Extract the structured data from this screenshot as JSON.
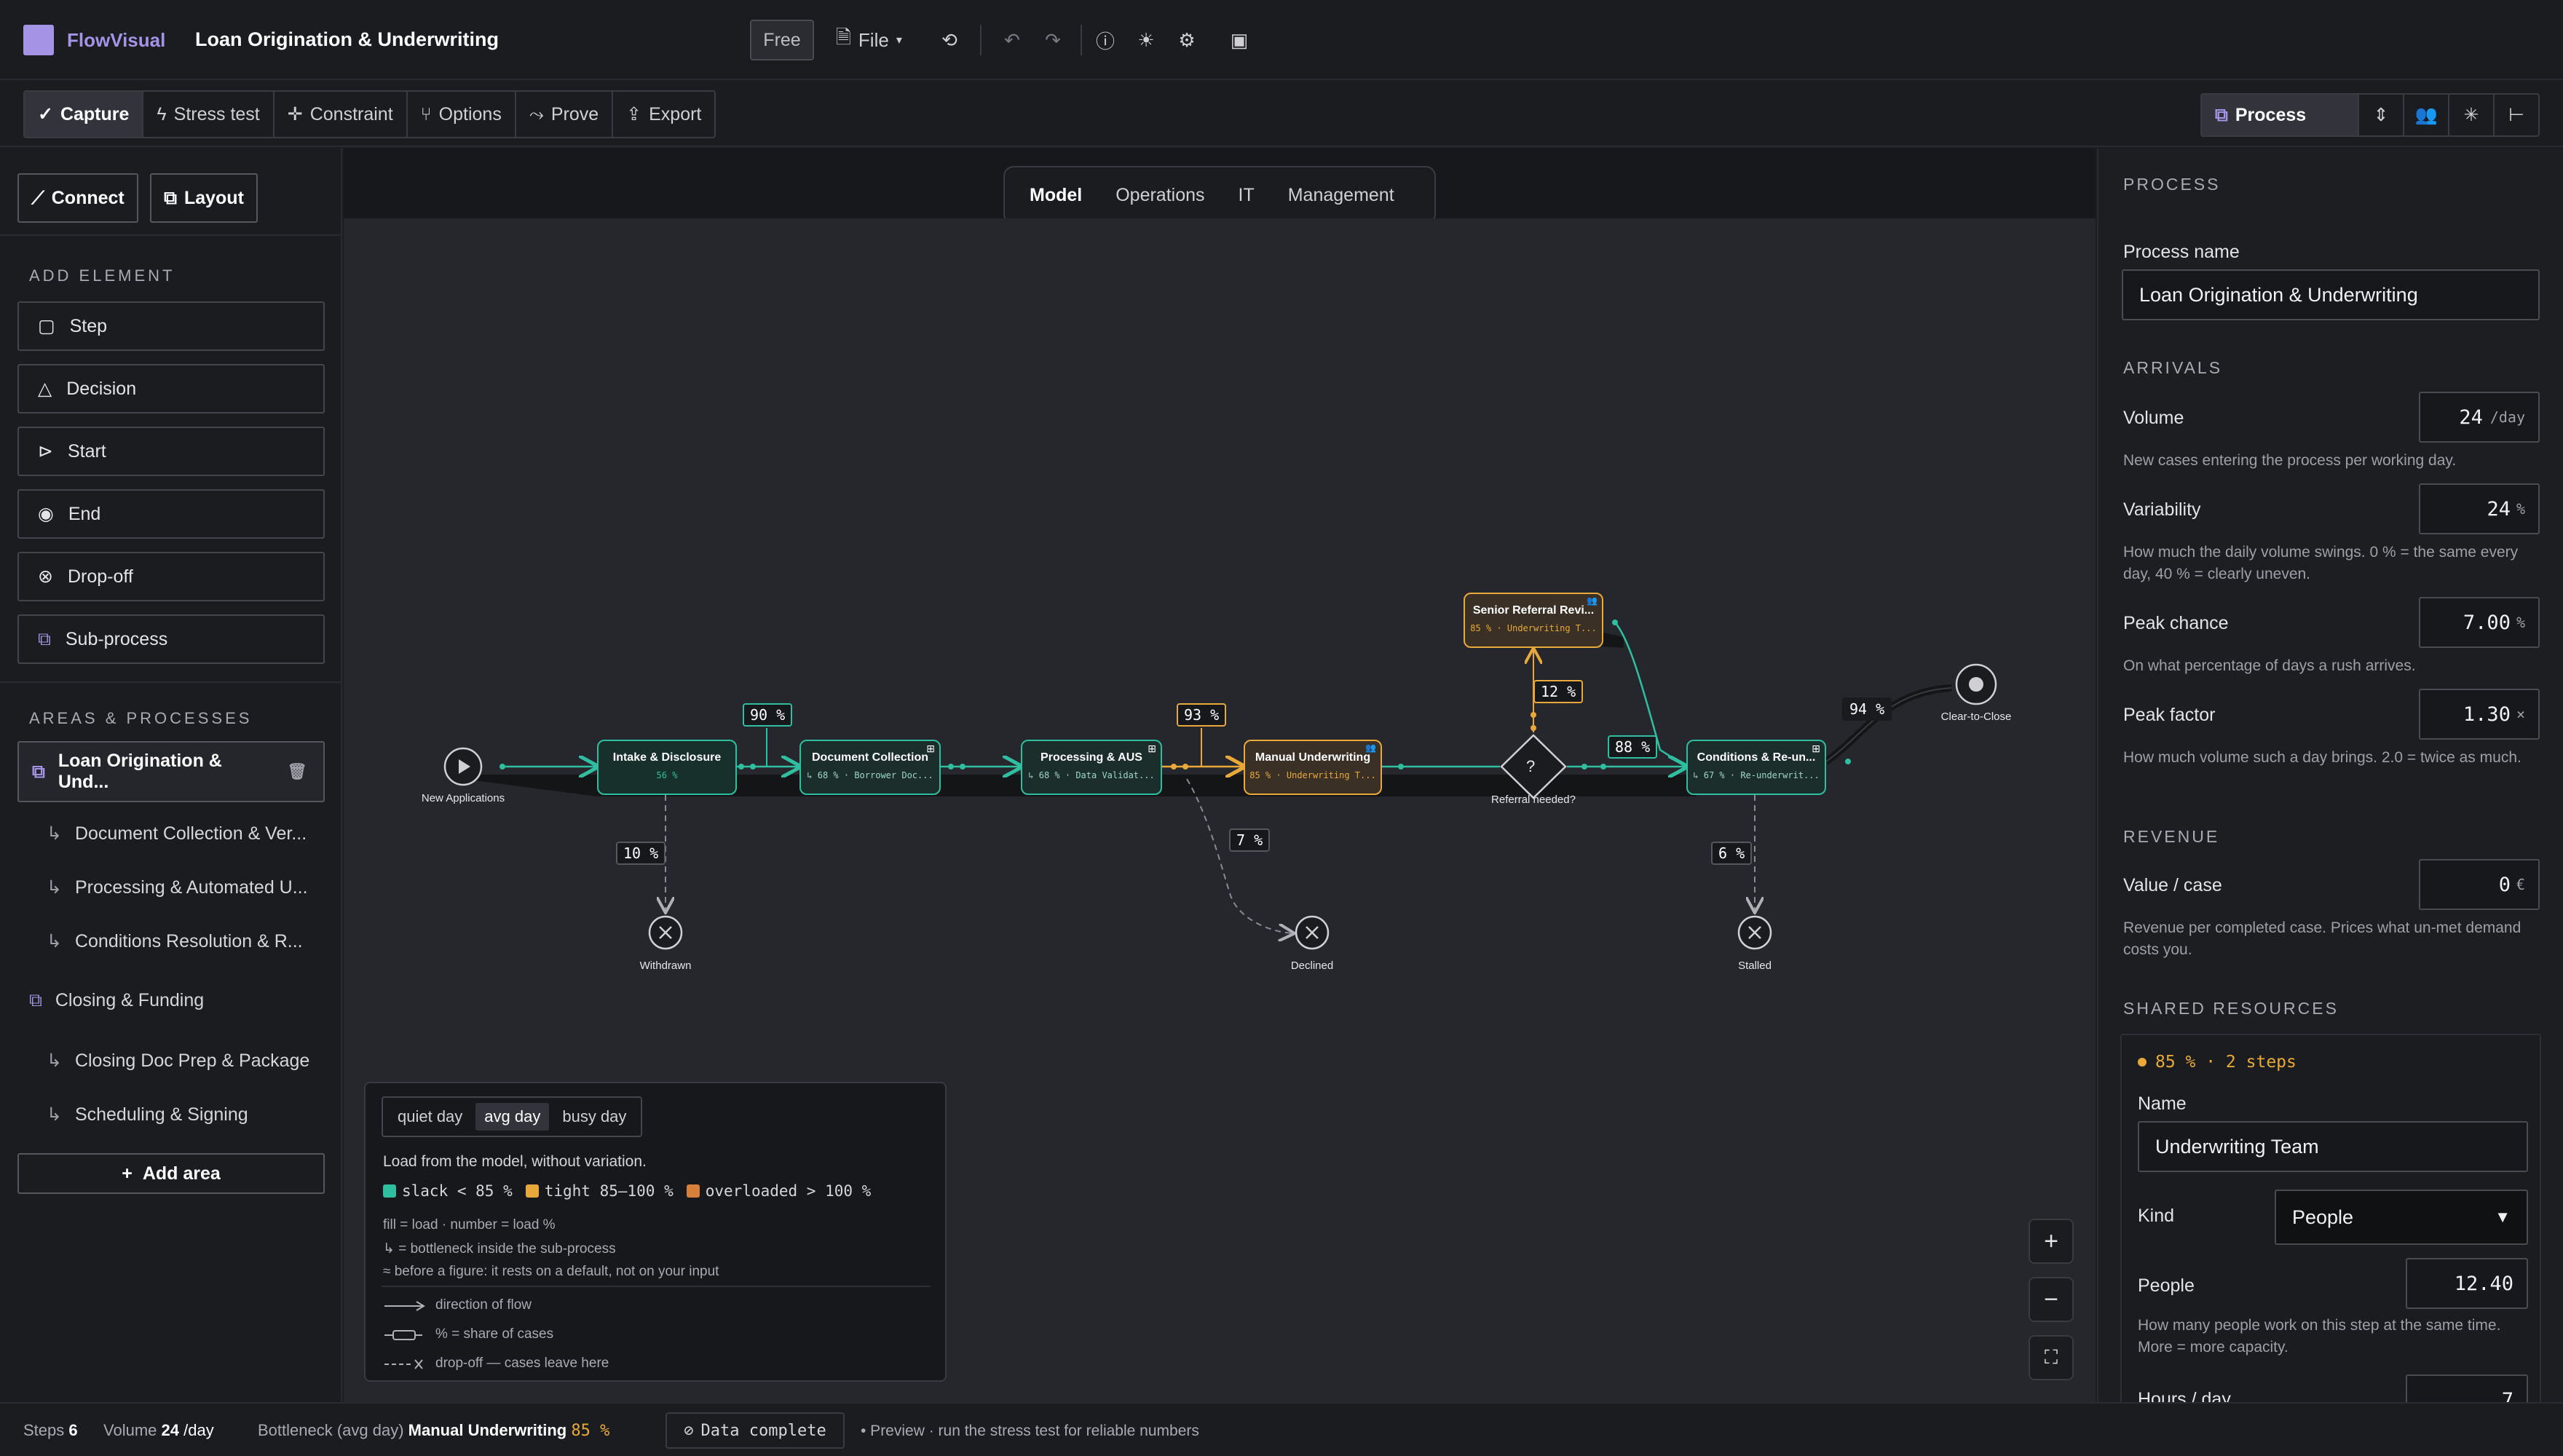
{
  "app": {
    "brand": "FlowVisual",
    "title": "Loan Origination & Underwriting",
    "plan_badge": "Free",
    "file_menu": "File"
  },
  "ribbon": {
    "modes": [
      "Capture",
      "Stress test",
      "Constraint",
      "Options",
      "Prove",
      "Export"
    ],
    "view_select": "Process"
  },
  "left": {
    "connect": "Connect",
    "layout": "Layout",
    "add_element_title": "ADD ELEMENT",
    "elements": [
      "Step",
      "Decision",
      "Start",
      "End",
      "Drop-off",
      "Sub-process"
    ],
    "areas_title": "AREAS & PROCESSES",
    "areas": [
      {
        "label": "Loan Origination & Und...",
        "level": 0,
        "selected": true
      },
      {
        "label": "Document Collection & Ver...",
        "level": 1
      },
      {
        "label": "Processing & Automated U...",
        "level": 1
      },
      {
        "label": "Conditions Resolution & R...",
        "level": 1
      },
      {
        "label": "Closing & Funding",
        "level": 0
      },
      {
        "label": "Closing Doc Prep & Package",
        "level": 1
      },
      {
        "label": "Scheduling & Signing",
        "level": 1
      }
    ],
    "add_area": "Add area"
  },
  "canvas": {
    "tabs": [
      "Model",
      "Operations",
      "IT",
      "Management"
    ],
    "active_tab": "Model",
    "nodes": {
      "start": "New Applications",
      "intake": {
        "title": "Intake & Disclosure",
        "sub": "56 %"
      },
      "doc": {
        "title": "Document Collection",
        "sub": "↳ 68 % · Borrower Doc..."
      },
      "proc": {
        "title": "Processing & AUS",
        "sub": "↳ 68 % · Data Validat..."
      },
      "manual": {
        "title": "Manual Underwriting",
        "sub": "85 % · Underwriting T..."
      },
      "senior": {
        "title": "Senior Referral Revi...",
        "sub": "85 % · Underwriting T..."
      },
      "cond": {
        "title": "Conditions & Re-un...",
        "sub": "↳ 67 % · Re-underwrit..."
      },
      "decision": "Referral needed?",
      "decision_mark": "?",
      "end": "Clear-to-Close",
      "withdrawn": "Withdrawn",
      "declined": "Declined",
      "stalled": "Stalled"
    },
    "edges": {
      "e90": "90 %",
      "e93": "93 %",
      "e12": "12 %",
      "e88": "88 %",
      "e94": "94 %",
      "e10": "10 %",
      "e7": "7 %",
      "e6": "6 %"
    }
  },
  "legend": {
    "days": [
      "quiet day",
      "avg day",
      "busy day"
    ],
    "active_day": "avg day",
    "desc": "Load from the model, without variation.",
    "slack": "slack < 85 %",
    "tight": "tight 85–100 %",
    "overloaded": "overloaded > 100 %",
    "notes": [
      "fill = load · number = load %",
      "↳ = bottleneck inside the sub-process",
      "≈ before a figure: it rests on a default, not on your input"
    ],
    "keys": [
      "direction of flow",
      "% = share of cases",
      "drop-off — cases leave here"
    ]
  },
  "right": {
    "section": "PROCESS",
    "process_name_label": "Process name",
    "process_name": "Loan Origination & Underwriting",
    "arrivals": "ARRIVALS",
    "volume_label": "Volume",
    "volume": "24",
    "volume_unit": "/day",
    "volume_help": "New cases entering the process per working day.",
    "variability_label": "Variability",
    "variability": "24",
    "variability_unit": "%",
    "variability_help": "How much the daily volume swings. 0 % = the same every day, 40 % = clearly uneven.",
    "peak_chance_label": "Peak chance",
    "peak_chance": "7.00",
    "peak_chance_unit": "%",
    "peak_chance_help": "On what percentage of days a rush arrives.",
    "peak_factor_label": "Peak factor",
    "peak_factor": "1.30",
    "peak_factor_unit": "×",
    "peak_factor_help": "How much volume such a day brings. 2.0 = twice as much.",
    "revenue": "REVENUE",
    "value_label": "Value / case",
    "value": "0",
    "value_unit": "€",
    "value_help": "Revenue per completed case. Prices what un-met demand costs you.",
    "shared": "SHARED RESOURCES",
    "res_summary": "85 % · 2 steps",
    "name_label": "Name",
    "res_name": "Underwriting Team",
    "kind_label": "Kind",
    "kind": "People",
    "people_label": "People",
    "people": "12.40",
    "people_help": "How many people work on this step at the same time. More = more capacity.",
    "hours_label": "Hours / day",
    "hours": "7"
  },
  "status": {
    "steps_label": "Steps",
    "steps": "6",
    "volume_label": "Volume",
    "volume": "24",
    "volume_unit": "/day",
    "bottleneck_label": "Bottleneck (avg day)",
    "bottleneck": "Manual Underwriting",
    "bottleneck_pct": "85 %",
    "data_complete": "Data complete",
    "preview": "• Preview · run the stress test for reliable numbers"
  },
  "colors": {
    "accent": "#a594e6",
    "slack": "#2fbfa0",
    "tight": "#e8a93a",
    "overloaded": "#d87f3a",
    "bg": "#1c1d21",
    "canvas": "#26272c"
  },
  "icons": [
    "logo-icon",
    "file-icon",
    "history-icon",
    "undo-icon",
    "redo-icon",
    "help-icon",
    "sun-icon",
    "gear-icon",
    "panel-icon",
    "check-icon",
    "bolt-icon",
    "plus-icon",
    "options-icon",
    "prove-icon",
    "export-icon",
    "process-icon",
    "sort-icon",
    "people-icon",
    "network-icon",
    "tree-icon",
    "trash-icon"
  ]
}
